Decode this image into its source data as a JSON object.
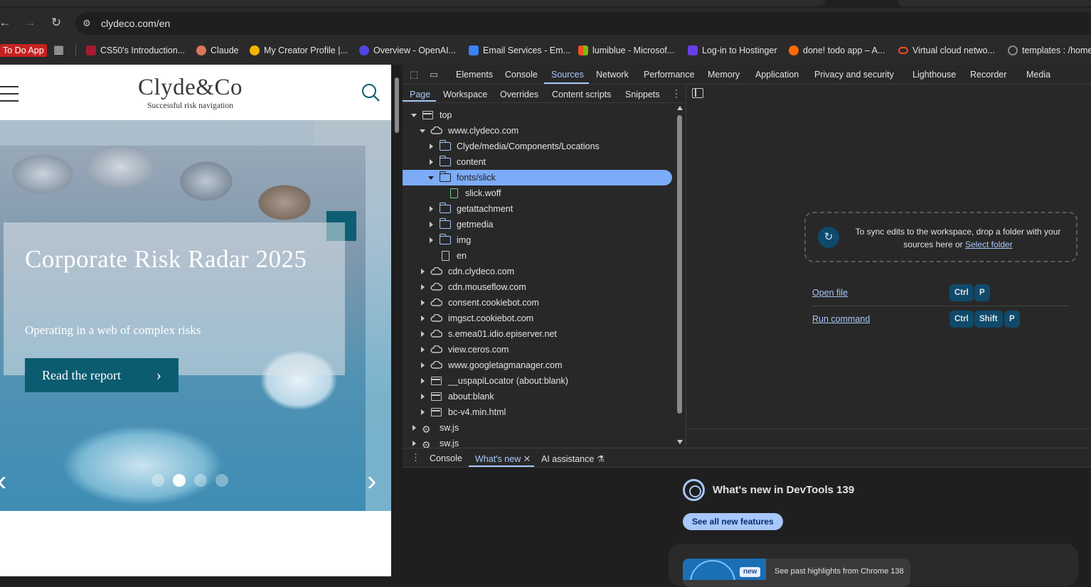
{
  "browser": {
    "url": "clydeco.com/en",
    "bookmarks": [
      {
        "label": "To Do App",
        "color": "#c5221f"
      },
      {
        "label": "CS50's Introduction...",
        "color": "#a51c30"
      },
      {
        "label": "Claude",
        "color": "#d97757"
      },
      {
        "label": "My Creator Profile |...",
        "color": "#f4b400"
      },
      {
        "label": "Overview - OpenAI...",
        "color": "#4f46e5"
      },
      {
        "label": "Email Services - Em...",
        "color": "#3b82f6"
      },
      {
        "label": "lumiblue - Microsof...",
        "color": "#00a4ef"
      },
      {
        "label": "Log-in to Hostinger",
        "color": "#673de6"
      },
      {
        "label": "done! todo app – A...",
        "color": "#ff6a00"
      },
      {
        "label": "Virtual cloud netwo...",
        "color": "#f04e23"
      },
      {
        "label": "templates : /home",
        "color": "#888888"
      }
    ]
  },
  "site": {
    "logo": "Clyde&Co",
    "tagline": "Successful risk navigation",
    "hero_title": "Corporate Risk Radar 2025",
    "hero_subtitle": "Operating in a web of complex risks",
    "hero_button": "Read the report",
    "carousel_active_index": 1,
    "carousel_count": 4
  },
  "devtools": {
    "tabs": [
      "Elements",
      "Console",
      "Sources",
      "Network",
      "Performance",
      "Memory",
      "Application",
      "Privacy and security",
      "Lighthouse",
      "Recorder",
      "Media"
    ],
    "active_tab": "Sources",
    "sub_tabs": [
      "Page",
      "Workspace",
      "Overrides",
      "Content scripts",
      "Snippets"
    ],
    "active_sub_tab": "Page",
    "tree": [
      {
        "label": "top",
        "icon": "frame-icon",
        "expanded": true
      },
      {
        "label": "www.clydeco.com",
        "icon": "cloud-icon",
        "expanded": true
      },
      {
        "label": "Clyde/media/Components/Locations",
        "icon": "folder-icon",
        "expanded": false
      },
      {
        "label": "content",
        "icon": "folder-icon",
        "expanded": false
      },
      {
        "label": "fonts/slick",
        "icon": "folder-icon",
        "expanded": true,
        "selected": true
      },
      {
        "label": "slick.woff",
        "icon": "file-icon"
      },
      {
        "label": "getattachment",
        "icon": "folder-icon",
        "expanded": false
      },
      {
        "label": "getmedia",
        "icon": "folder-icon",
        "expanded": false
      },
      {
        "label": "img",
        "icon": "folder-icon",
        "expanded": false
      },
      {
        "label": "en",
        "icon": "file-icon"
      },
      {
        "label": "cdn.clydeco.com",
        "icon": "cloud-icon",
        "expanded": false
      },
      {
        "label": "cdn.mouseflow.com",
        "icon": "cloud-icon",
        "expanded": false
      },
      {
        "label": "consent.cookiebot.com",
        "icon": "cloud-icon",
        "expanded": false
      },
      {
        "label": "imgsct.cookiebot.com",
        "icon": "cloud-icon",
        "expanded": false
      },
      {
        "label": "s.emea01.idio.episerver.net",
        "icon": "cloud-icon",
        "expanded": false
      },
      {
        "label": "view.ceros.com",
        "icon": "cloud-icon",
        "expanded": false
      },
      {
        "label": "www.googletagmanager.com",
        "icon": "cloud-icon",
        "expanded": false
      },
      {
        "label": "__uspapiLocator (about:blank)",
        "icon": "frame-icon",
        "expanded": false
      },
      {
        "label": "about:blank",
        "icon": "frame-icon",
        "expanded": false
      },
      {
        "label": "bc-v4.min.html",
        "icon": "frame-icon",
        "expanded": false
      },
      {
        "label": "sw.js",
        "icon": "gear-icon",
        "expanded": false
      },
      {
        "label": "sw.js",
        "icon": "gear-icon",
        "expanded": false
      }
    ],
    "workspace": {
      "drop_text": "To sync edits to the workspace, drop a folder with your sources here or",
      "select_folder": "Select folder",
      "open_file": "Open file",
      "run_command": "Run command",
      "key_ctrl": "Ctrl",
      "key_shift": "Shift",
      "key_p": "P"
    },
    "drawer": {
      "tabs": [
        "Console",
        "What's new",
        "AI assistance"
      ],
      "active_tab": "What's new",
      "whats_new_title": "What's new in DevTools 139",
      "see_all": "See all new features",
      "new_badge": "new",
      "past_highlights": "See past highlights from Chrome 138"
    }
  }
}
